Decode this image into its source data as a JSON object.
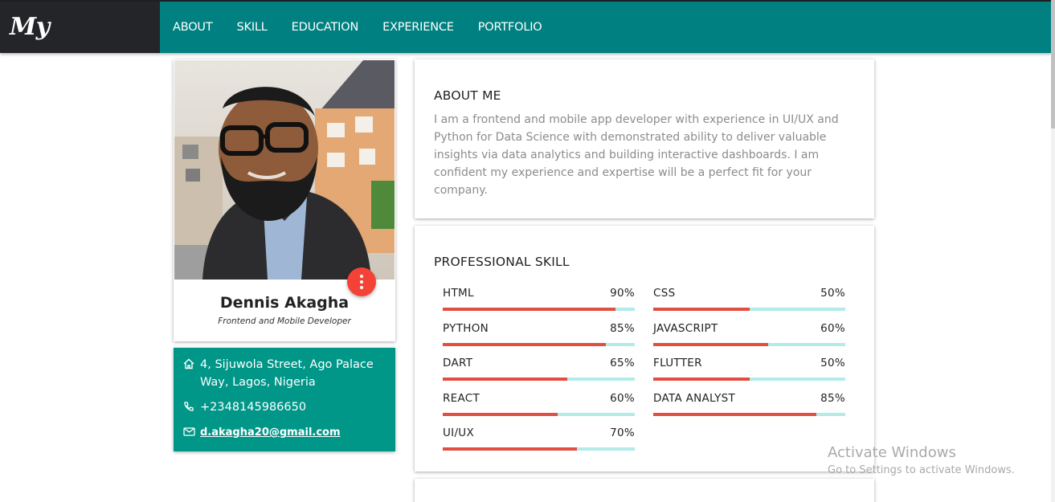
{
  "header": {
    "brand": "My Resume",
    "nav": [
      "ABOUT",
      "SKILL",
      "EDUCATION",
      "EXPERIENCE",
      "PORTFOLIO"
    ]
  },
  "profile": {
    "name": "Dennis Akagha",
    "role": "Frontend and Mobile Developer"
  },
  "contact": {
    "address": "4, Sijuwola Street, Ago Palace Way, Lagos, Nigeria",
    "phone": "+2348145986650",
    "email": "d.akagha20@gmail.com"
  },
  "about": {
    "title": "ABOUT ME",
    "text": "I am a frontend and mobile app developer with experience in UI/UX and Python for Data Science with demonstrated ability to deliver valuable insights via data analytics and building interactive dashboards. I am confident my experience and expertise will be a perfect fit for your company."
  },
  "skills": {
    "title": "PROFESSIONAL SKILL",
    "items": [
      {
        "name": "HTML",
        "percent": "90%",
        "value": 90
      },
      {
        "name": "CSS",
        "percent": "50%",
        "value": 50
      },
      {
        "name": "PYTHON",
        "percent": "85%",
        "value": 85
      },
      {
        "name": "JAVASCRIPT",
        "percent": "60%",
        "value": 60
      },
      {
        "name": "DART",
        "percent": "65%",
        "value": 65
      },
      {
        "name": "FLUTTER",
        "percent": "50%",
        "value": 50
      },
      {
        "name": "REACT",
        "percent": "60%",
        "value": 60
      },
      {
        "name": "DATA ANALYST",
        "percent": "85%",
        "value": 85
      },
      {
        "name": "UI/UX",
        "percent": "70%",
        "value": 70
      }
    ]
  },
  "watermark": {
    "title": "Activate Windows",
    "subtitle": "Go to Settings to activate Windows."
  },
  "colors": {
    "header": "#008080",
    "brand_bg": "#242528",
    "contact_bg": "#009688",
    "fab": "#f44336",
    "bar_fill": "#e04f3f",
    "bar_track": "#b2ebe8"
  }
}
